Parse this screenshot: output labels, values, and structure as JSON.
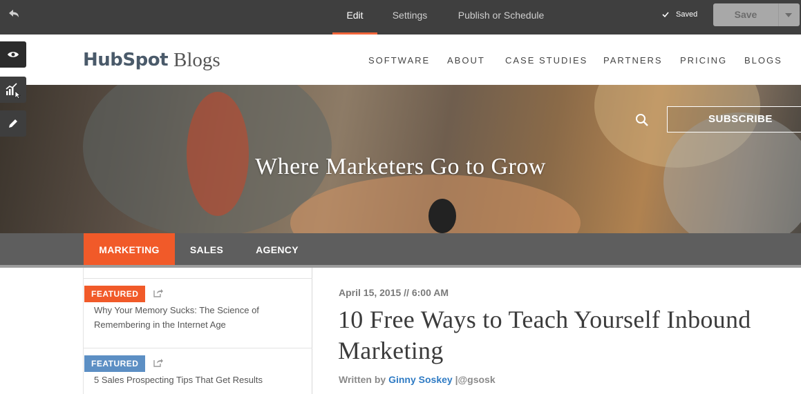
{
  "editor": {
    "tabs": [
      "Edit",
      "Settings",
      "Publish or Schedule"
    ],
    "saved_label": "Saved",
    "save_button": "Save"
  },
  "blog": {
    "logo_brand": "HubSpot",
    "logo_suffix": "Blogs",
    "nav": [
      "SOFTWARE",
      "ABOUT",
      "CASE STUDIES",
      "PARTNERS",
      "PRICING",
      "BLOGS"
    ]
  },
  "hero": {
    "title": "Where Marketers Go to Grow",
    "subscribe": "SUBSCRIBE"
  },
  "categories": [
    "MARKETING",
    "SALES",
    "AGENCY"
  ],
  "featured": [
    {
      "badge": "FEATURED",
      "title": "Why Your Memory Sucks: The Science of Remembering in the Internet Age"
    },
    {
      "badge": "FEATURED",
      "title": "5 Sales Prospecting Tips That Get Results"
    }
  ],
  "post": {
    "date": "April 15, 2015 // 6:00 AM",
    "title": "10 Free Ways to Teach Yourself Inbound Marketing",
    "written_by": "Written by",
    "author": "Ginny Soskey",
    "separator": "|",
    "handle": "@gsosk"
  },
  "colors": {
    "accent": "#f15a29",
    "badge_marketing": "#f15a29",
    "badge_sales": "#5c8fc4",
    "link": "#2f7bc4"
  },
  "icons": [
    "undo-icon",
    "check-icon",
    "eye-icon",
    "chart-icon",
    "pencil-icon",
    "search-icon",
    "share-icon"
  ]
}
